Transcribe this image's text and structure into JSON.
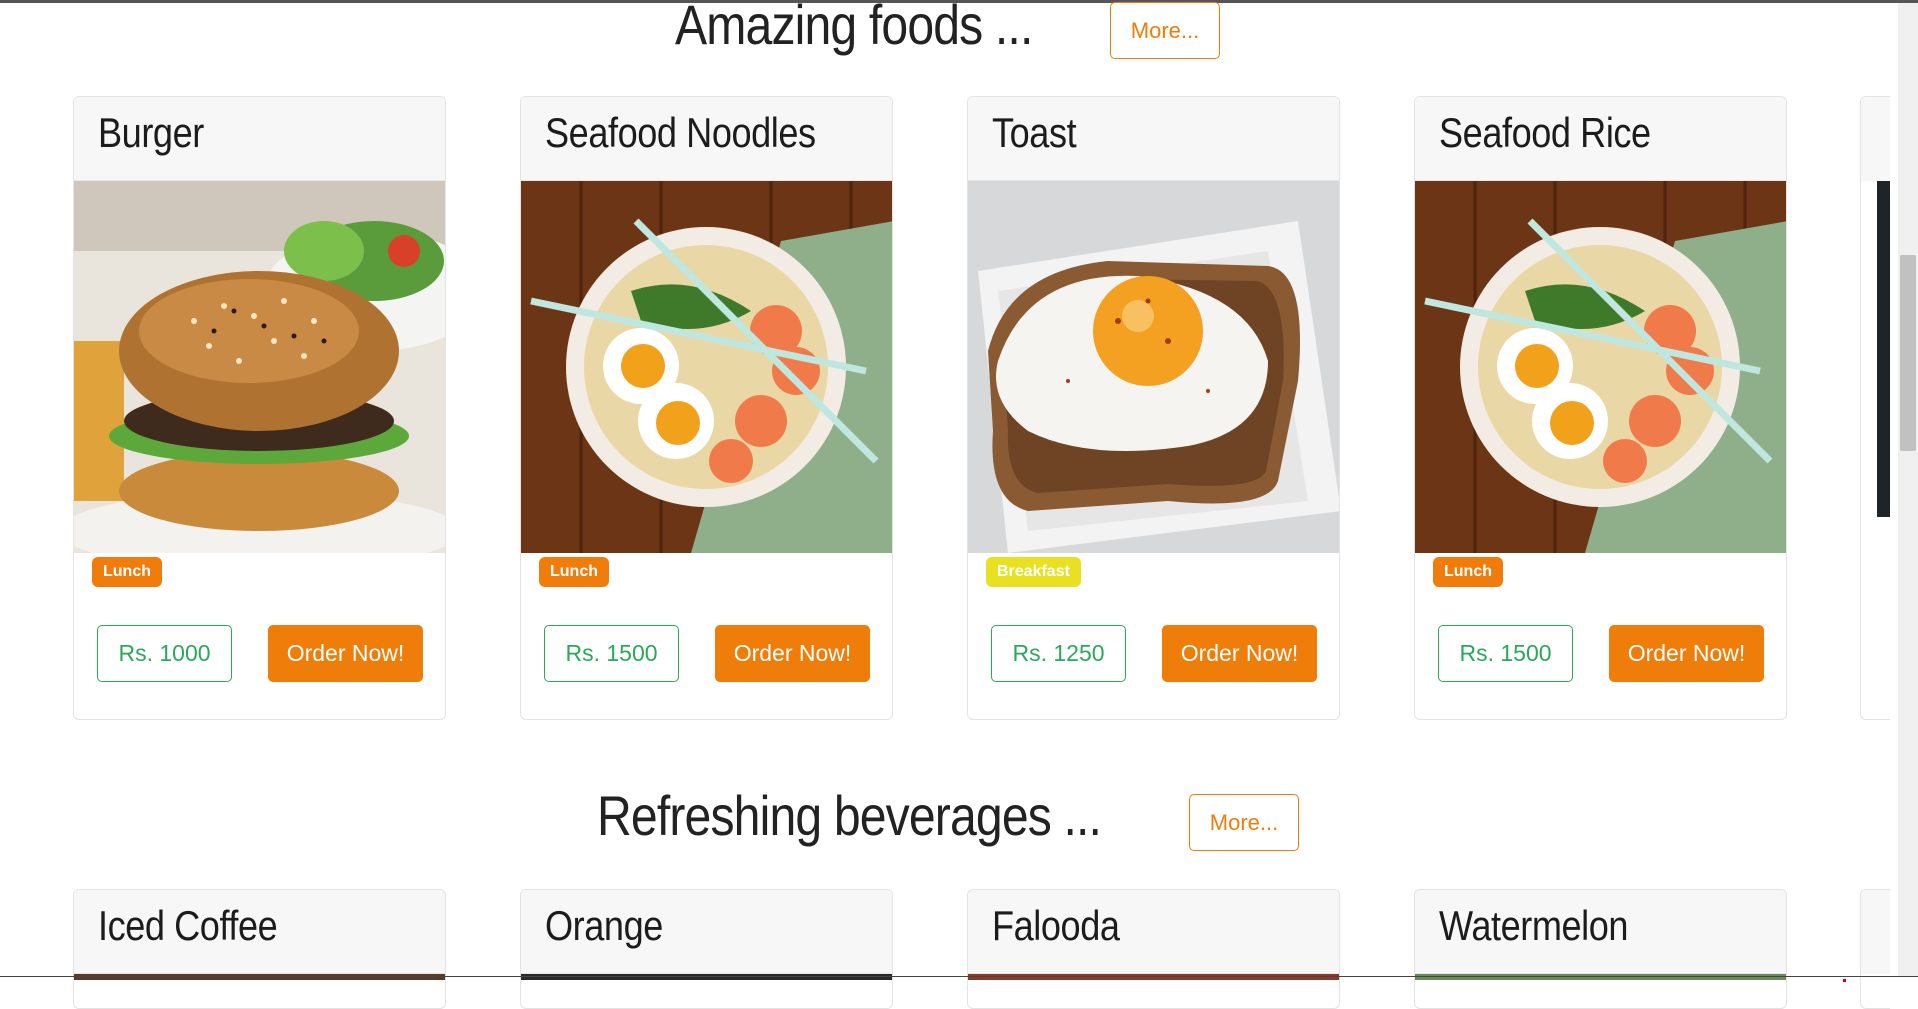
{
  "foods_section": {
    "title": "Amazing foods ...",
    "more_label": "More..."
  },
  "foods": [
    {
      "name": "Burger",
      "badge": "Lunch",
      "badge_type": "lunch",
      "price": "Rs. 1000",
      "order_label": "Order Now!",
      "image": "burger-photo"
    },
    {
      "name": "Seafood Noodles",
      "badge": "Lunch",
      "badge_type": "lunch",
      "price": "Rs. 1500",
      "order_label": "Order Now!",
      "image": "noodles-photo"
    },
    {
      "name": "Toast",
      "badge": "Breakfast",
      "badge_type": "breakfast",
      "price": "Rs. 1250",
      "order_label": "Order Now!",
      "image": "toast-photo"
    },
    {
      "name": "Seafood Rice",
      "badge": "Lunch",
      "badge_type": "lunch",
      "price": "Rs. 1500",
      "order_label": "Order Now!",
      "image": "noodles-photo"
    }
  ],
  "beverages_section": {
    "title": "Refreshing beverages ...",
    "more_label": "More..."
  },
  "beverages": [
    {
      "name": "Iced Coffee"
    },
    {
      "name": "Orange"
    },
    {
      "name": "Falooda"
    },
    {
      "name": "Watermelon"
    }
  ],
  "colors": {
    "accent": "#ee7d0a",
    "price_green": "#2aa958",
    "lunch_badge": "#f07c0b",
    "breakfast_badge": "#e9e021"
  }
}
